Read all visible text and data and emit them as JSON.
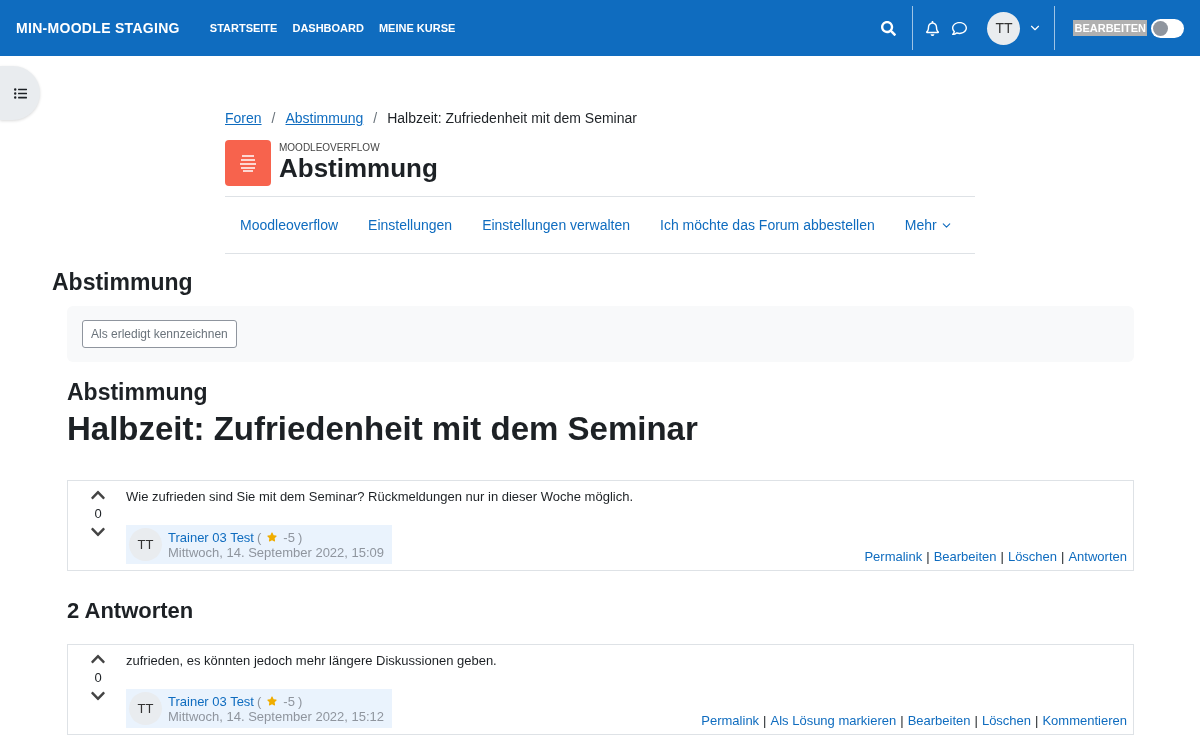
{
  "navbar": {
    "brand": "MIN-MOODLE STAGING",
    "links": [
      {
        "label": "STARTSEITE"
      },
      {
        "label": "DASHBOARD"
      },
      {
        "label": "MEINE KURSE"
      }
    ],
    "avatar": "TT",
    "edit_mode": {
      "label": "BEARBEITEN",
      "on": false
    }
  },
  "breadcrumb_separator": "/",
  "breadcrumb": [
    {
      "label": "Foren",
      "link": true
    },
    {
      "label": "Abstimmung",
      "link": true
    },
    {
      "label": "Halbzeit: Zufriedenheit mit dem Seminar",
      "link": false
    }
  ],
  "activity": {
    "type_label": "MOODLEOVERFLOW",
    "title": "Abstimmung"
  },
  "secondary_nav": [
    {
      "label": "Moodleoverflow",
      "dropdown": false
    },
    {
      "label": "Einstellungen",
      "dropdown": false
    },
    {
      "label": "Einstellungen verwalten",
      "dropdown": false
    },
    {
      "label": "Ich möchte das Forum abbestellen",
      "dropdown": false
    },
    {
      "label": "Mehr",
      "dropdown": true
    }
  ],
  "page_heading": "Abstimmung",
  "completion": {
    "button": "Als erledigt kennzeichnen"
  },
  "discussion": {
    "forum": "Abstimmung",
    "title": "Halbzeit: Zufriedenheit mit dem Seminar"
  },
  "posts": [
    {
      "votes": "0",
      "text": "Wie zufrieden sind Sie mit dem Seminar? Rückmeldungen nur in dieser Woche möglich.",
      "author": {
        "initials": "TT",
        "name": "Trainer 03 Test",
        "bracket_open": "(",
        "reputation": "-5",
        "bracket_close": ")",
        "date": "Mittwoch, 14. September 2022, 15:09"
      },
      "separator": "|",
      "actions": [
        "Permalink",
        "Bearbeiten",
        "Löschen",
        "Antworten"
      ]
    }
  ],
  "answers_heading": "2 Antworten",
  "answers": [
    {
      "votes": "0",
      "text": "zufrieden, es könnten jedoch mehr längere Diskussionen geben.",
      "author": {
        "initials": "TT",
        "name": "Trainer 03 Test",
        "bracket_open": "(",
        "reputation": "-5",
        "bracket_close": ")",
        "date": "Mittwoch, 14. September 2022, 15:12"
      },
      "separator": "|",
      "actions": [
        "Permalink",
        "Als Lösung markieren",
        "Bearbeiten",
        "Löschen",
        "Kommentieren"
      ]
    }
  ]
}
